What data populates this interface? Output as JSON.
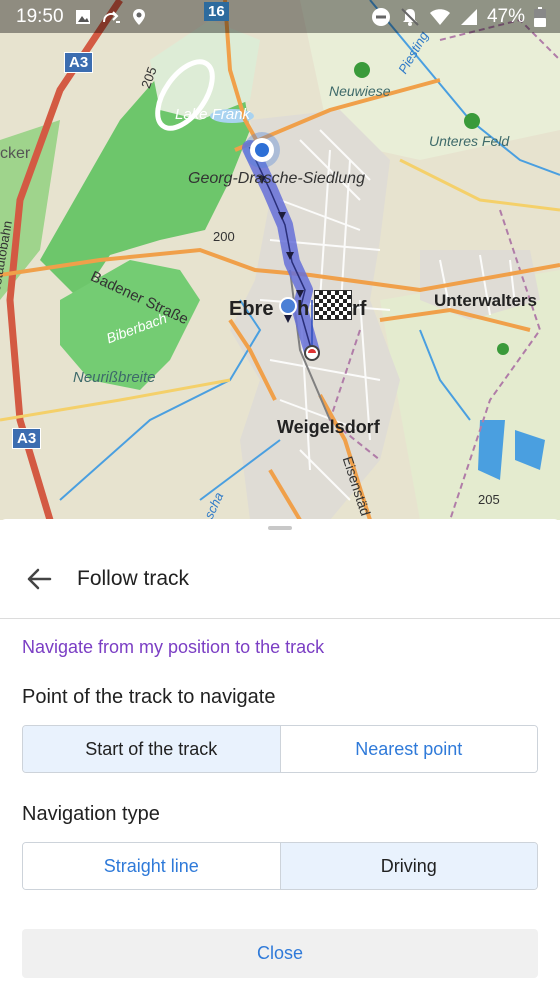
{
  "status_bar": {
    "time": "19:50",
    "battery_percent": "47%",
    "left_icons": [
      "image-icon",
      "call-forward-icon",
      "location-pin-icon"
    ],
    "right_icons": [
      "do-not-disturb-icon",
      "notifications-off-icon",
      "wifi-icon",
      "signal-icon",
      "battery-icon"
    ]
  },
  "map": {
    "road_badges": {
      "a3_top": "A3",
      "road_16": "16",
      "a3_bottom": "A3"
    },
    "labels": {
      "lake_frank": "Lake Frank",
      "neuwiese": "Neuwiese",
      "piesting": "Piesting",
      "unteres_feld": "Unteres Feld",
      "cker": "cker",
      "georg_drasche": "Georg-Drasche-Siedlung",
      "badener_strasse": "Badener Straße",
      "elev_200": "200",
      "elev_205": "205",
      "elev_205b": "205",
      "suedost": "Südostautobahn",
      "ebreichsdorf_left": "Ebre",
      "ebreichsdorf_mid": "h",
      "ebreichsdorf_right": "rf",
      "unterwalters": "Unterwalters",
      "biberbach": "Biberbach",
      "neurissbreite": "Neurißbreite",
      "weigelsdorf": "Weigelsdorf",
      "eisenstadt": "Eisenstäd",
      "fischa": "scha"
    },
    "colors": {
      "background": "#e7e3cf",
      "forest": "#6dc66b",
      "motorway": "#d35a43",
      "primary_road": "#f0a04a",
      "route": "#6670d8",
      "water": "#4a9fe0"
    }
  },
  "sheet": {
    "title": "Follow track",
    "section_title": "Navigate from my position to the track",
    "point_label": "Point of the track to navigate",
    "point_options": [
      "Start of the track",
      "Nearest point"
    ],
    "point_selected": "Start of the track",
    "nav_type_label": "Navigation type",
    "nav_options": [
      "Straight line",
      "Driving"
    ],
    "nav_selected": "Driving",
    "close_label": "Close",
    "colors": {
      "accent": "#2f7ad9",
      "section": "#7b3ec4",
      "selected_bg": "#e9f2fd"
    }
  }
}
